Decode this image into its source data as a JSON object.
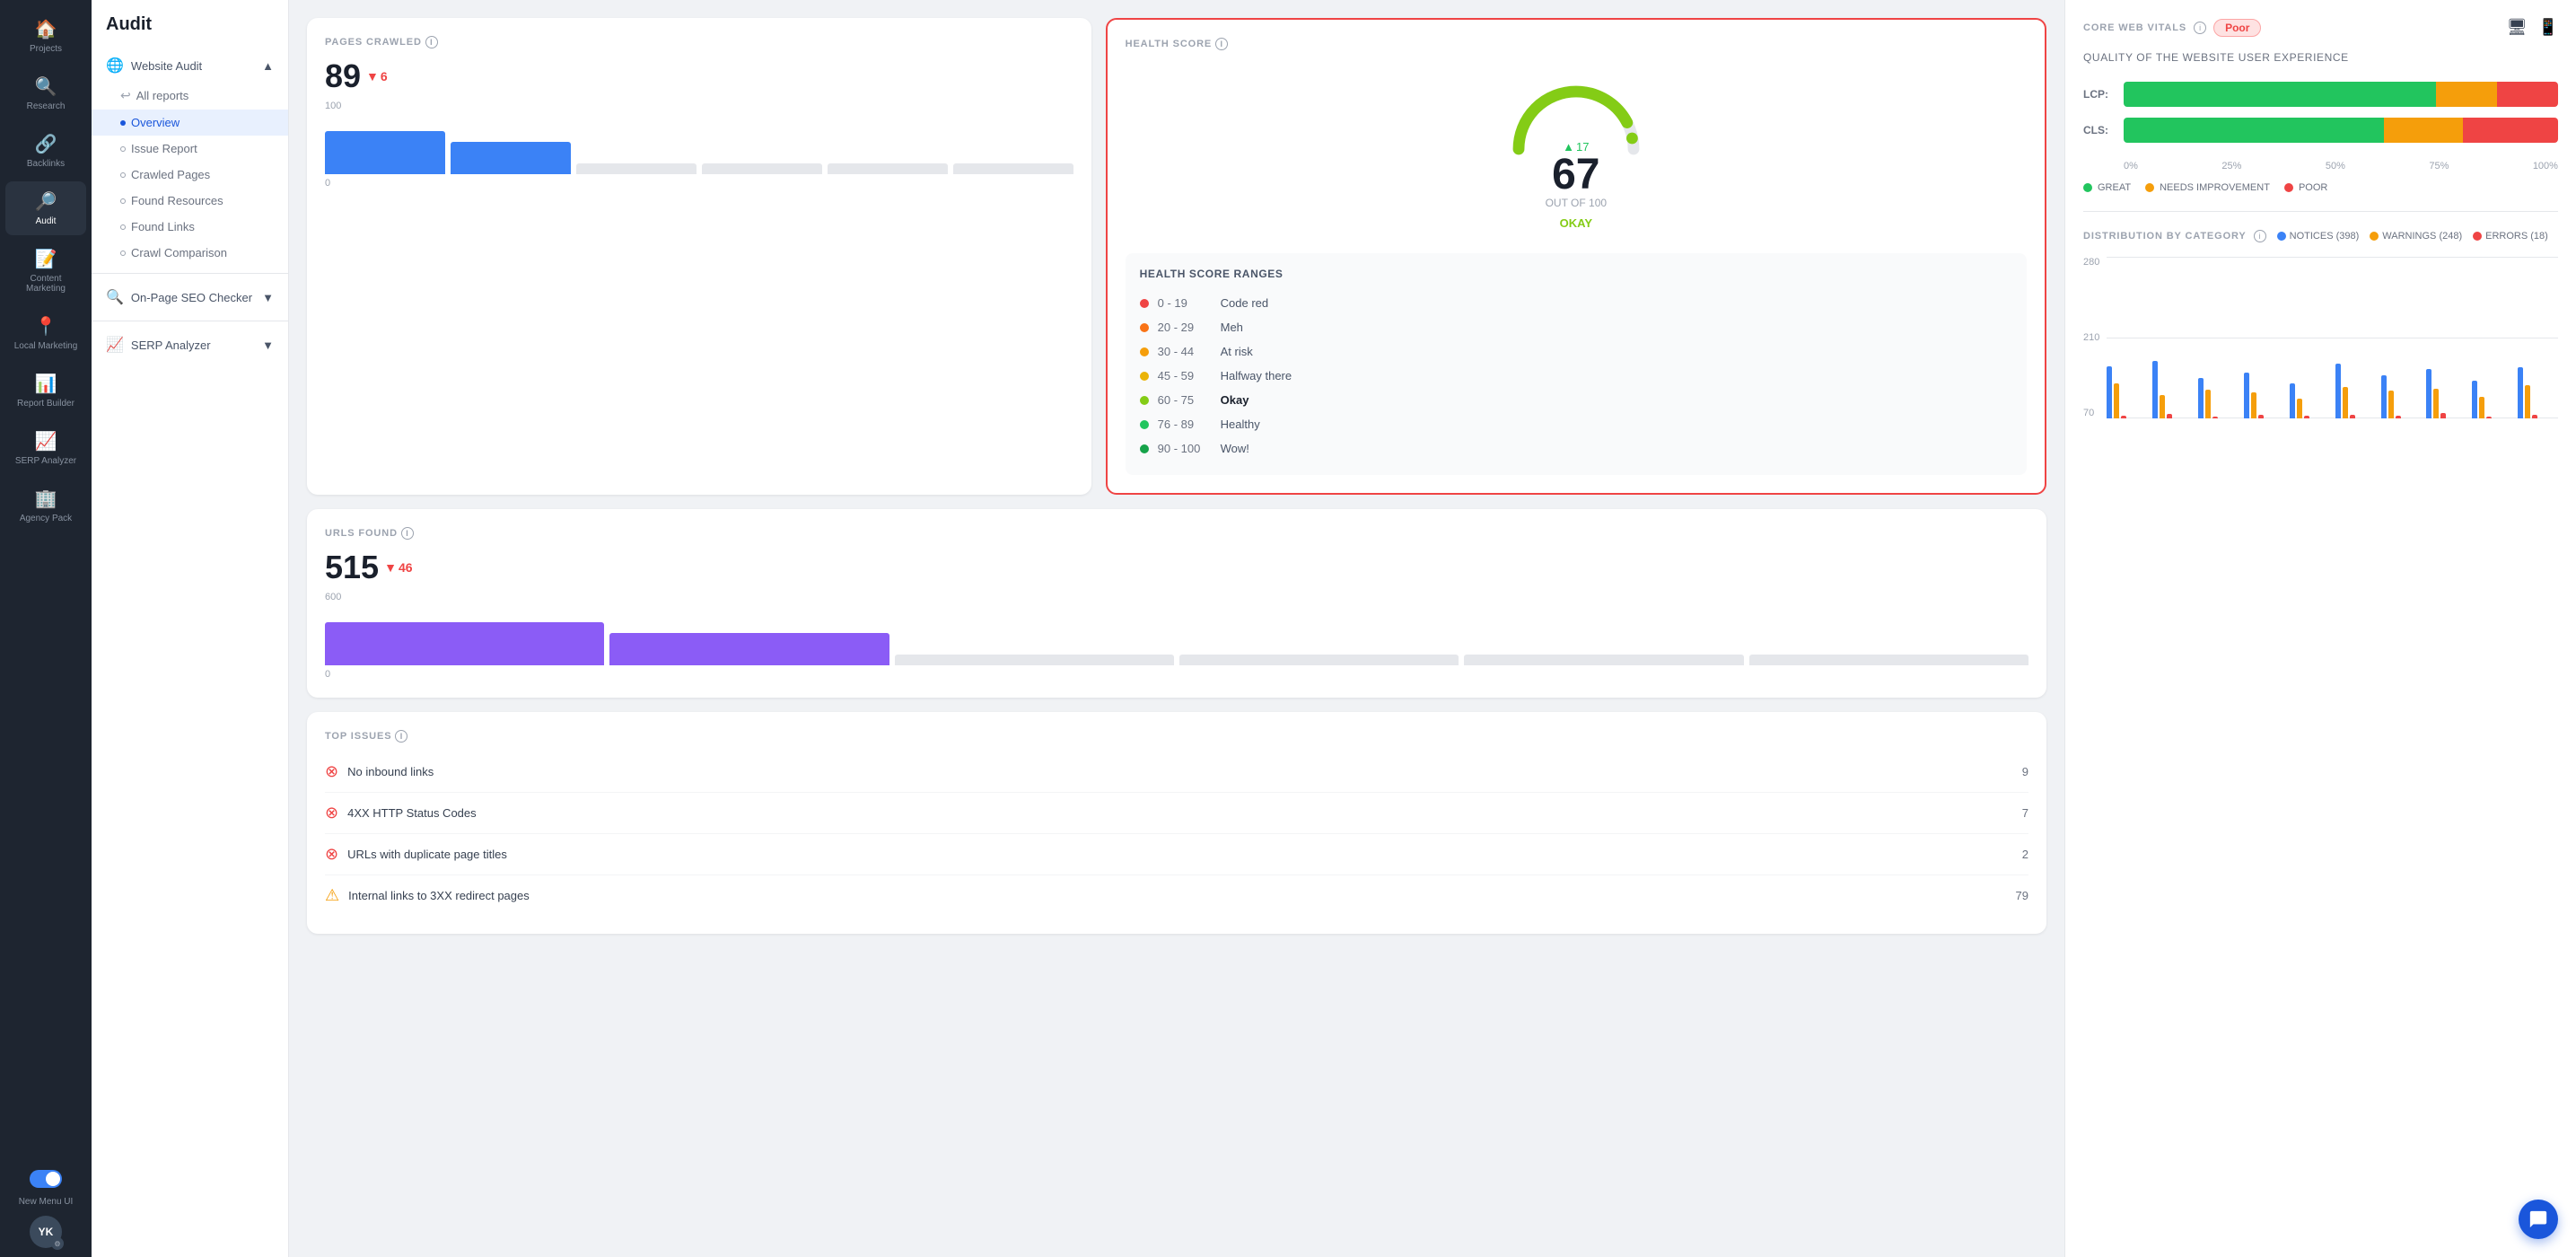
{
  "sidebar": {
    "items": [
      {
        "id": "projects",
        "label": "Projects",
        "icon": "🏠",
        "active": false
      },
      {
        "id": "research",
        "label": "Research",
        "icon": "🔍",
        "active": false
      },
      {
        "id": "backlinks",
        "label": "Backlinks",
        "icon": "🔗",
        "active": false
      },
      {
        "id": "audit",
        "label": "Audit",
        "icon": "🔎",
        "active": true
      },
      {
        "id": "content-marketing",
        "label": "Content Marketing",
        "icon": "📝",
        "active": false
      },
      {
        "id": "local-marketing",
        "label": "Local Marketing",
        "icon": "📍",
        "active": false
      },
      {
        "id": "report-builder",
        "label": "Report Builder",
        "icon": "📊",
        "active": false
      },
      {
        "id": "serp-analyzer",
        "label": "SERP Analyzer",
        "icon": "📈",
        "active": false
      },
      {
        "id": "agency-pack",
        "label": "Agency Pack",
        "icon": "🏢",
        "active": false
      }
    ],
    "new_menu_label": "New Menu UI",
    "avatar_initials": "YK",
    "toggle_active": true
  },
  "nav": {
    "title": "Audit",
    "sections": [
      {
        "id": "website-audit",
        "label": "Website Audit",
        "expanded": true,
        "items": [
          {
            "id": "all-reports",
            "label": "All reports",
            "active": false,
            "indent": true
          },
          {
            "id": "overview",
            "label": "Overview",
            "active": true,
            "indent": true
          },
          {
            "id": "issue-report",
            "label": "Issue Report",
            "active": false,
            "indent": true
          },
          {
            "id": "crawled-pages",
            "label": "Crawled Pages",
            "active": false,
            "indent": true
          },
          {
            "id": "found-resources",
            "label": "Found Resources",
            "active": false,
            "indent": true
          },
          {
            "id": "found-links",
            "label": "Found Links",
            "active": false,
            "indent": true
          },
          {
            "id": "crawl-comparison",
            "label": "Crawl Comparison",
            "active": false,
            "indent": true
          }
        ]
      },
      {
        "id": "on-page-seo",
        "label": "On-Page SEO Checker",
        "expanded": false,
        "items": []
      },
      {
        "id": "serp-analyzer",
        "label": "SERP Analyzer",
        "expanded": false,
        "items": []
      }
    ]
  },
  "pages_crawled": {
    "title": "PAGES CRAWLED",
    "value": "89",
    "change": "6",
    "change_direction": "down",
    "chart_bars": [
      {
        "height": 80,
        "color": "#3b82f6"
      },
      {
        "height": 60,
        "color": "#3b82f6"
      },
      {
        "height": 20,
        "color": "#e5e7eb"
      },
      {
        "height": 20,
        "color": "#e5e7eb"
      },
      {
        "height": 20,
        "color": "#e5e7eb"
      },
      {
        "height": 20,
        "color": "#e5e7eb"
      }
    ],
    "y_max": "100",
    "y_min": "0"
  },
  "urls_found": {
    "title": "URLS FOUND",
    "value": "515",
    "change": "46",
    "change_direction": "down",
    "chart_bars": [
      {
        "height": 80,
        "color": "#8b5cf6"
      },
      {
        "height": 60,
        "color": "#8b5cf6"
      },
      {
        "height": 20,
        "color": "#e5e7eb"
      },
      {
        "height": 20,
        "color": "#e5e7eb"
      },
      {
        "height": 20,
        "color": "#e5e7eb"
      },
      {
        "height": 20,
        "color": "#e5e7eb"
      }
    ],
    "y_max": "600",
    "y_min": "0"
  },
  "health_score": {
    "title": "HEALTH SCORE",
    "score": "67",
    "change": "17",
    "change_direction": "up",
    "out_of": "OUT OF 100",
    "status": "OKAY",
    "ranges_title": "HEALTH SCORE RANGES",
    "ranges": [
      {
        "min": "0",
        "max": "19",
        "label": "Code red",
        "color": "#ef4444",
        "bold": false
      },
      {
        "min": "20",
        "max": "29",
        "label": "Meh",
        "color": "#f97316",
        "bold": false
      },
      {
        "min": "30",
        "max": "44",
        "label": "At risk",
        "color": "#f59e0b",
        "bold": false
      },
      {
        "min": "45",
        "max": "59",
        "label": "Halfway there",
        "color": "#eab308",
        "bold": false
      },
      {
        "min": "60",
        "max": "75",
        "label": "Okay",
        "color": "#84cc16",
        "bold": true
      },
      {
        "min": "76",
        "max": "89",
        "label": "Healthy",
        "color": "#22c55e",
        "bold": false
      },
      {
        "min": "90",
        "max": "100",
        "label": "Wow!",
        "color": "#16a34a",
        "bold": false
      }
    ]
  },
  "top_issues": {
    "title": "TOP ISSUES",
    "items": [
      {
        "type": "error",
        "label": "No inbound links",
        "count": "9"
      },
      {
        "type": "error",
        "label": "4XX HTTP Status Codes",
        "count": "7"
      },
      {
        "type": "error",
        "label": "URLs with duplicate page titles",
        "count": "2"
      },
      {
        "type": "warning",
        "label": "Internal links to 3XX redirect pages",
        "count": "79"
      }
    ]
  },
  "core_web_vitals": {
    "title": "CORE WEB VITALS",
    "status": "Poor",
    "quality_title": "QUALITY OF THE WEBSITE USER EXPERIENCE",
    "lcp_label": "LCP:",
    "cls_label": "CLS:",
    "lcp_bars": {
      "green": 72,
      "yellow": 14,
      "red": 14
    },
    "cls_bars": {
      "green": 60,
      "yellow": 18,
      "red": 22
    },
    "axis_labels": [
      "0%",
      "25%",
      "50%",
      "75%",
      "100%"
    ],
    "legend": [
      {
        "label": "GREAT",
        "color": "#22c55e"
      },
      {
        "label": "NEEDS IMPROVEMENT",
        "color": "#f59e0b"
      },
      {
        "label": "POOR",
        "color": "#ef4444"
      }
    ]
  },
  "distribution": {
    "title": "DISTRIBUTION BY CATEGORY",
    "notices_label": "NOTICES (398)",
    "warnings_label": "WARNINGS (248)",
    "errors_label": "ERRORS (18)",
    "notices_color": "#3b82f6",
    "warnings_color": "#f59e0b",
    "errors_color": "#ef4444",
    "y_labels": [
      "280",
      "210",
      "70"
    ],
    "bars": [
      {
        "notices": 90,
        "warnings": 60,
        "errors": 5
      },
      {
        "notices": 100,
        "warnings": 40,
        "errors": 8
      },
      {
        "notices": 70,
        "warnings": 50,
        "errors": 3
      },
      {
        "notices": 80,
        "warnings": 45,
        "errors": 6
      },
      {
        "notices": 60,
        "warnings": 35,
        "errors": 4
      },
      {
        "notices": 95,
        "warnings": 55,
        "errors": 7
      },
      {
        "notices": 75,
        "warnings": 48,
        "errors": 5
      },
      {
        "notices": 85,
        "warnings": 52,
        "errors": 9
      },
      {
        "notices": 65,
        "warnings": 38,
        "errors": 3
      },
      {
        "notices": 88,
        "warnings": 58,
        "errors": 6
      }
    ]
  }
}
